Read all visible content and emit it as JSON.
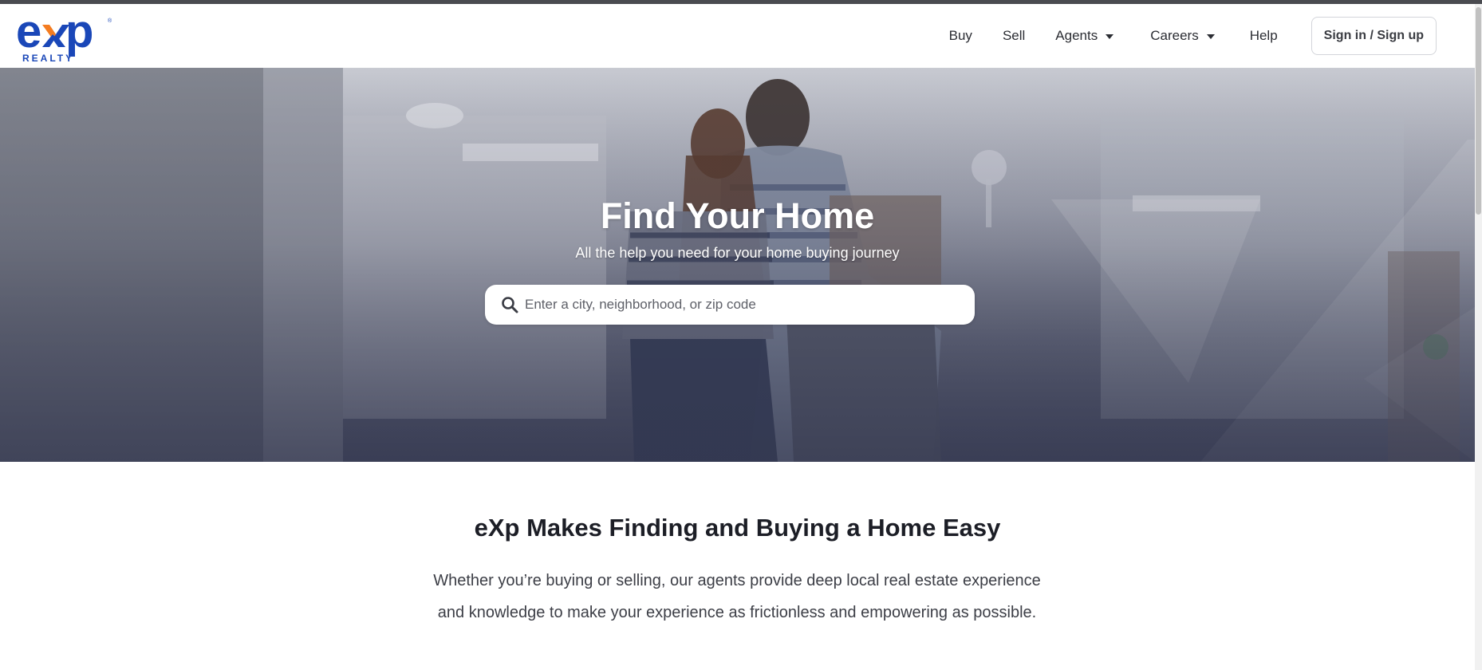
{
  "brand": {
    "logo_text": "eXp",
    "logo_subtext": "REALTY",
    "logo_mark": "®",
    "colors": {
      "logo_blue": "#1a47b8",
      "logo_orange": "#f47c20",
      "text_dark": "#1c1e26"
    }
  },
  "nav": {
    "buy": "Buy",
    "sell": "Sell",
    "agents": "Agents",
    "careers": "Careers",
    "help": "Help",
    "signin": "Sign in / Sign up"
  },
  "hero": {
    "title": "Find Your Home",
    "subtitle": "All the help you need for your home buying journey",
    "search_placeholder": "Enter a city, neighborhood, or zip code",
    "search_value": ""
  },
  "intro": {
    "title": "eXp Makes Finding and Buying a Home Easy",
    "text": "Whether you’re buying or selling, our agents provide deep local real estate experience and knowledge to make your experience as frictionless and empowering as possible."
  },
  "icons": {
    "search": "search-icon",
    "dropdown": "caret-down-icon"
  }
}
